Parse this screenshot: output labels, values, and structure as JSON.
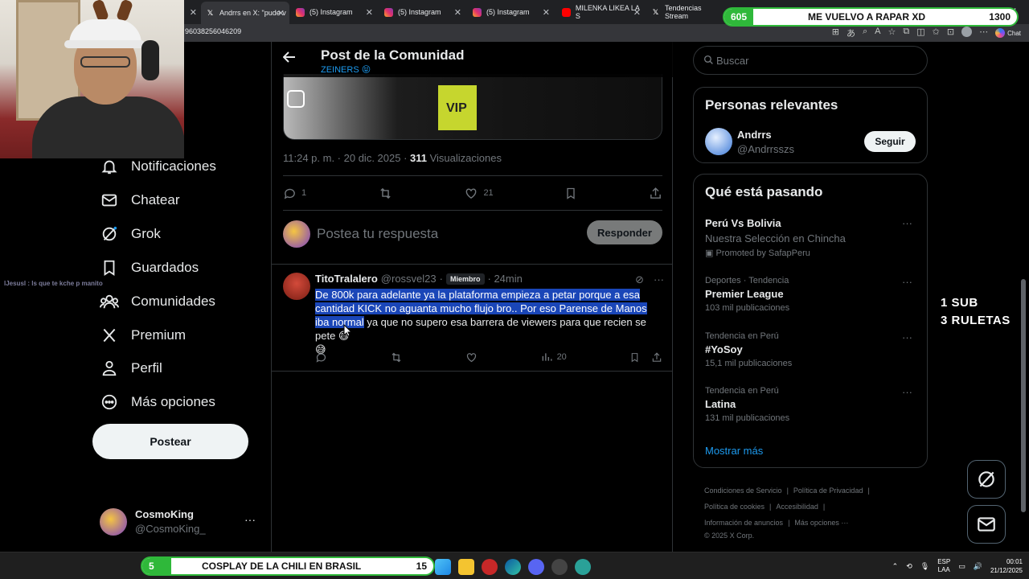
{
  "browser": {
    "tabs": [
      {
        "label": "Andrrs en X: \"pude v",
        "icon": "x",
        "active": true
      },
      {
        "label": "(5) Instagram",
        "icon": "instagram"
      },
      {
        "label": "(5) Instagram",
        "icon": "instagram"
      },
      {
        "label": "(5) Instagram",
        "icon": "instagram"
      },
      {
        "label": "MILENKA LIKEA LA S",
        "icon": "youtube"
      },
      {
        "label": "Tendencias Stream",
        "icon": "x"
      }
    ],
    "url_fragment": "96038256046209",
    "chat_label": "Chat"
  },
  "stream": {
    "top_pill": {
      "left": "605",
      "middle": "ME VUELVO A RAPAR XD",
      "right": "1300",
      "progress": 0.1
    },
    "bottom_pill": {
      "left": "5",
      "middle": "COSPLAY DE LA CHILI EN BRASIL",
      "right": "15",
      "progress": 0.1
    },
    "goal_lines": [
      "1 SUB",
      "3 RULETAS"
    ],
    "chat_line": "lJesusl : ls que te kche p manito"
  },
  "nav": {
    "items": [
      {
        "label": "Notificaciones",
        "icon": "bell-icon"
      },
      {
        "label": "Chatear",
        "icon": "mail-icon"
      },
      {
        "label": "Grok",
        "icon": "grok-icon"
      },
      {
        "label": "Guardados",
        "icon": "bookmark-icon"
      },
      {
        "label": "Comunidades",
        "icon": "communities-icon"
      },
      {
        "label": "Premium",
        "icon": "x-logo-icon"
      },
      {
        "label": "Perfil",
        "icon": "person-icon"
      },
      {
        "label": "Más opciones",
        "icon": "more-circle-icon"
      }
    ],
    "post_button": "Postear",
    "profile": {
      "name": "CosmoKing",
      "handle": "@CosmoKing_",
      "more": "···"
    }
  },
  "post": {
    "header_title": "Post de la Comunidad",
    "header_sub": "ZEINERS 😝",
    "vip_text": "VIP",
    "time": "11:24 p. m. · 20 dic. 2025 · ",
    "views_count": "311",
    "views_label": " Visualizaciones",
    "replies": "1",
    "likes": "21",
    "reply_placeholder": "Postea tu respuesta",
    "reply_button": "Responder"
  },
  "reply": {
    "name": "TitoTralalero",
    "handle": "@rossvel23",
    "dot": "·",
    "badge": "Miembro",
    "time": "· 24min",
    "text_highlighted": "De 800k para adelante ya la plataforma empieza a petar porque a esa cantidad KICK no aguanta mucho flujo bro.. Por eso Parense de Manos iba normal",
    "text_rest": " ya que no supero esa barrera de viewers para que recien se pete 😅",
    "text_line2": "😅",
    "views": "20"
  },
  "right": {
    "search_placeholder": "Buscar",
    "relevant_title": "Personas relevantes",
    "relevant_user": {
      "name": "Andrrs",
      "handle": "@Andrrsszs",
      "follow": "Seguir"
    },
    "happening_title": "Qué está pasando",
    "trends": [
      {
        "category": "",
        "title": "Perú Vs Bolivia",
        "sub": "Nuestra Selección en Chincha",
        "promo": "Promoted by SafapPeru"
      },
      {
        "category": "Deportes · Tendencia",
        "title": "Premier League",
        "sub": "103 mil publicaciones"
      },
      {
        "category": "Tendencia en Perú",
        "title": "#YoSoy",
        "sub": "15,1 mil publicaciones"
      },
      {
        "category": "Tendencia en Perú",
        "title": "Latina",
        "sub": "131 mil publicaciones"
      }
    ],
    "show_more": "Mostrar más",
    "footer": {
      "line1": [
        "Condiciones de Servicio",
        "Política de Privacidad"
      ],
      "line2": [
        "Política de cookies",
        "Accesibilidad"
      ],
      "line3": [
        "Información de anuncios",
        "Más opciones ···"
      ],
      "copyright": "© 2025 X Corp."
    }
  },
  "taskbar": {
    "lang": "ESP",
    "lang2": "LAA",
    "time": "00:01",
    "date": "21/12/2025"
  },
  "colors": {
    "accent": "#1d9bf0",
    "highlight": "#1a46b8",
    "pill_green": "#2fb83a"
  }
}
